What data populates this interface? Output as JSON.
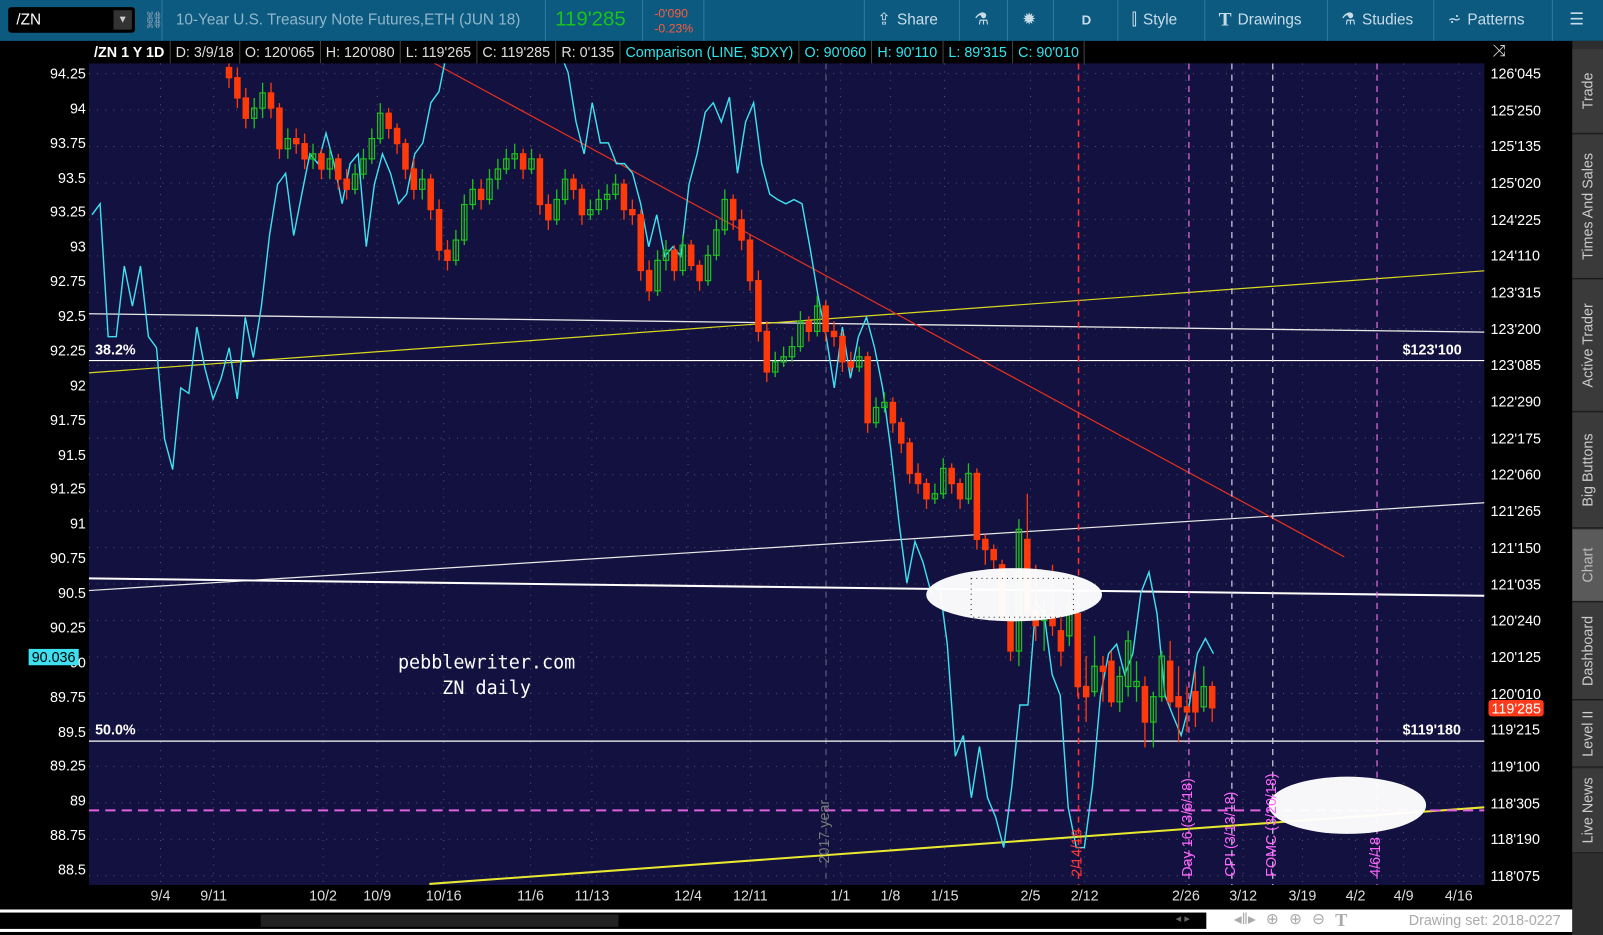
{
  "toolbar": {
    "symbol": "/ZN",
    "title": "10-Year U.S. Treasury Note Futures,ETH (JUN 18)",
    "last_price": "119'285",
    "net_change": "-0'090",
    "pct_change": "-0.23%",
    "share": "Share",
    "aggregation": "D",
    "style": "Style",
    "drawings": "Drawings",
    "studies": "Studies",
    "patterns": "Patterns",
    "icons": [
      "chevron-down-icon",
      "link-icon",
      "share-icon",
      "flask-icon",
      "gear-icon",
      "candles-icon",
      "text-t-icon",
      "flask-icon",
      "patterns-icon",
      "menu-icon"
    ]
  },
  "info": {
    "symbol": "/ZN 1 Y 1D",
    "date": "D: 3/9/18",
    "open": "O: 120'065",
    "high": "H: 120'080",
    "low": "L: 119'265",
    "close": "C: 119'285",
    "range": "R: 0'135",
    "comparison": "Comparison (LINE, $DXY)",
    "cmp_open": "O: 90'060",
    "cmp_high": "H: 90'110",
    "cmp_low": "L: 89'315",
    "cmp_close": "C: 90'010"
  },
  "colors": {
    "up": "#1fbf1f",
    "down": "#ff3a0a",
    "comparison": "#3ee0f0",
    "background": "#13113f",
    "toolbar": "#0d5a80"
  },
  "chart_data": {
    "type": "candlestick",
    "series": [
      {
        "name": "/ZN",
        "type": "candlestick",
        "ohlc_format": [
          "open",
          "high",
          "low",
          "close"
        ],
        "last_date": "3/9/18",
        "values": [
          [
            126.2,
            126.3,
            126.0,
            126.1
          ],
          [
            126.1,
            126.2,
            125.8,
            125.9
          ],
          [
            125.9,
            126.0,
            125.6,
            125.7
          ],
          [
            125.7,
            125.9,
            125.6,
            125.8
          ],
          [
            125.8,
            126.05,
            125.7,
            125.95
          ],
          [
            125.95,
            126.05,
            125.7,
            125.8
          ],
          [
            125.8,
            125.85,
            125.3,
            125.4
          ],
          [
            125.4,
            125.6,
            125.3,
            125.5
          ],
          [
            125.5,
            125.6,
            125.35,
            125.45
          ],
          [
            125.45,
            125.55,
            125.2,
            125.3
          ],
          [
            125.3,
            125.45,
            125.2,
            125.35
          ],
          [
            125.35,
            125.4,
            125.1,
            125.2
          ],
          [
            125.2,
            125.4,
            125.1,
            125.3
          ],
          [
            125.3,
            125.35,
            125.0,
            125.1
          ],
          [
            125.1,
            125.2,
            124.9,
            125.0
          ],
          [
            125.0,
            125.25,
            124.95,
            125.15
          ],
          [
            125.15,
            125.4,
            125.1,
            125.3
          ],
          [
            125.3,
            125.6,
            125.25,
            125.5
          ],
          [
            125.5,
            125.85,
            125.45,
            125.75
          ],
          [
            125.75,
            125.8,
            125.5,
            125.6
          ],
          [
            125.6,
            125.65,
            125.35,
            125.45
          ],
          [
            125.45,
            125.5,
            125.1,
            125.2
          ],
          [
            125.2,
            125.3,
            124.9,
            125.0
          ],
          [
            125.0,
            125.2,
            124.9,
            125.1
          ],
          [
            125.1,
            125.15,
            124.7,
            124.8
          ],
          [
            124.8,
            124.9,
            124.3,
            124.4
          ],
          [
            124.4,
            124.5,
            124.2,
            124.3
          ],
          [
            124.3,
            124.6,
            124.25,
            124.5
          ],
          [
            124.5,
            124.95,
            124.45,
            124.85
          ],
          [
            124.85,
            125.1,
            124.8,
            125.0
          ],
          [
            125.0,
            125.1,
            124.8,
            124.9
          ],
          [
            124.9,
            125.2,
            124.85,
            125.1
          ],
          [
            125.1,
            125.3,
            125.0,
            125.2
          ],
          [
            125.2,
            125.4,
            125.15,
            125.3
          ],
          [
            125.3,
            125.45,
            125.2,
            125.35
          ],
          [
            125.35,
            125.4,
            125.1,
            125.2
          ],
          [
            125.2,
            125.4,
            125.15,
            125.3
          ],
          [
            125.3,
            125.35,
            124.75,
            124.85
          ],
          [
            124.85,
            124.95,
            124.6,
            124.7
          ],
          [
            124.7,
            125.0,
            124.65,
            124.9
          ],
          [
            124.9,
            125.2,
            124.85,
            125.1
          ],
          [
            125.1,
            125.15,
            124.9,
            125.0
          ],
          [
            125.0,
            125.05,
            124.65,
            124.75
          ],
          [
            124.75,
            124.9,
            124.7,
            124.8
          ],
          [
            124.8,
            125.0,
            124.75,
            124.9
          ],
          [
            124.9,
            125.05,
            124.8,
            124.95
          ],
          [
            124.95,
            125.15,
            124.9,
            125.05
          ],
          [
            125.05,
            125.1,
            124.7,
            124.8
          ],
          [
            124.8,
            124.9,
            124.65,
            124.75
          ],
          [
            124.75,
            124.8,
            124.1,
            124.2
          ],
          [
            124.2,
            124.3,
            123.9,
            124.0
          ],
          [
            124.0,
            124.4,
            123.95,
            124.3
          ],
          [
            124.3,
            124.5,
            124.2,
            124.4
          ],
          [
            124.4,
            124.45,
            124.1,
            124.2
          ],
          [
            124.2,
            124.55,
            124.15,
            124.45
          ],
          [
            124.45,
            124.5,
            124.2,
            124.25
          ],
          [
            124.25,
            124.3,
            124.0,
            124.1
          ],
          [
            124.1,
            124.45,
            124.05,
            124.35
          ],
          [
            124.35,
            124.7,
            124.3,
            124.6
          ],
          [
            124.6,
            125.0,
            124.55,
            124.9
          ],
          [
            124.9,
            124.95,
            124.6,
            124.7
          ],
          [
            124.7,
            124.8,
            124.4,
            124.5
          ],
          [
            124.5,
            124.55,
            124.0,
            124.1
          ],
          [
            124.1,
            124.2,
            123.5,
            123.6
          ],
          [
            123.6,
            123.7,
            123.1,
            123.2
          ],
          [
            123.2,
            123.4,
            123.15,
            123.3
          ],
          [
            123.3,
            123.45,
            123.25,
            123.35
          ],
          [
            123.35,
            123.55,
            123.3,
            123.45
          ],
          [
            123.45,
            123.8,
            123.4,
            123.7
          ],
          [
            123.7,
            123.75,
            123.5,
            123.6
          ],
          [
            123.6,
            123.95,
            123.55,
            123.85
          ],
          [
            123.85,
            123.9,
            123.5,
            123.6
          ],
          [
            123.6,
            123.7,
            123.45,
            123.55
          ],
          [
            123.55,
            123.6,
            123.2,
            123.3
          ],
          [
            123.3,
            123.4,
            123.2,
            123.25
          ],
          [
            123.25,
            123.45,
            123.2,
            123.35
          ],
          [
            123.35,
            123.4,
            122.6,
            122.7
          ],
          [
            122.7,
            122.95,
            122.65,
            122.85
          ],
          [
            122.85,
            123.0,
            122.8,
            122.9
          ],
          [
            122.9,
            122.95,
            122.6,
            122.7
          ],
          [
            122.7,
            122.75,
            122.4,
            122.5
          ],
          [
            122.5,
            122.55,
            122.1,
            122.2
          ],
          [
            122.2,
            122.3,
            122.0,
            122.1
          ],
          [
            122.1,
            122.15,
            121.85,
            121.95
          ],
          [
            121.95,
            122.1,
            121.9,
            122.0
          ],
          [
            122.0,
            122.35,
            121.95,
            122.25
          ],
          [
            122.25,
            122.3,
            122.0,
            122.1
          ],
          [
            122.1,
            122.15,
            121.85,
            121.95
          ],
          [
            121.95,
            122.3,
            121.9,
            122.2
          ],
          [
            122.2,
            122.25,
            121.45,
            121.55
          ],
          [
            121.55,
            121.6,
            121.3,
            121.45
          ],
          [
            121.45,
            121.5,
            121.25,
            121.35
          ],
          [
            121.3,
            121.35,
            120.75,
            120.8
          ],
          [
            120.75,
            120.8,
            120.35,
            120.45
          ],
          [
            120.45,
            121.75,
            120.3,
            121.65
          ],
          [
            121.55,
            122.0,
            120.8,
            120.85
          ],
          [
            120.85,
            121.3,
            120.55,
            120.7
          ],
          [
            120.75,
            120.95,
            120.45,
            120.8
          ],
          [
            120.8,
            121.3,
            120.6,
            120.7
          ],
          [
            120.65,
            120.85,
            120.3,
            120.45
          ],
          [
            120.6,
            121.0,
            120.5,
            120.9
          ],
          [
            120.82,
            121.0,
            120.0,
            120.1
          ],
          [
            120.1,
            120.4,
            119.75,
            120.0
          ],
          [
            120.05,
            120.6,
            120.0,
            120.3
          ],
          [
            120.3,
            120.4,
            119.95,
            120.25
          ],
          [
            120.35,
            120.45,
            119.9,
            119.95
          ],
          [
            119.95,
            120.3,
            119.85,
            120.2
          ],
          [
            120.1,
            120.65,
            120.0,
            120.55
          ],
          [
            120.1,
            120.35,
            119.95,
            120.15
          ],
          [
            120.1,
            120.2,
            119.5,
            119.75
          ],
          [
            119.75,
            120.05,
            119.5,
            120.0
          ],
          [
            120.0,
            120.45,
            119.95,
            120.4
          ],
          [
            120.35,
            120.55,
            119.9,
            119.95
          ],
          [
            120.0,
            120.3,
            119.55,
            119.9
          ],
          [
            119.9,
            120.1,
            119.65,
            119.85
          ],
          [
            120.05,
            120.25,
            119.7,
            119.85
          ],
          [
            119.9,
            120.3,
            119.85,
            120.1
          ],
          [
            120.1,
            120.15,
            119.75,
            119.89
          ]
        ]
      },
      {
        "name": "$DXY",
        "type": "line",
        "last_date": "3/9/18",
        "values": [
          93.23,
          93.31,
          92.35,
          92.35,
          92.86,
          92.57,
          92.86,
          92.35,
          92.27,
          91.61,
          91.39,
          91.98,
          91.94,
          92.42,
          92.12,
          91.9,
          92.05,
          92.27,
          91.9,
          92.49,
          92.2,
          92.57,
          93.08,
          93.45,
          93.53,
          93.08,
          93.38,
          93.67,
          93.6,
          93.82,
          93.6,
          93.31,
          93.6,
          93.67,
          93.0,
          93.45,
          93.67,
          93.53,
          93.31,
          93.38,
          93.67,
          93.75,
          94.04,
          94.12,
          94.41,
          94.6,
          94.7,
          94.6,
          94.5,
          94.6,
          94.7,
          94.8,
          94.6,
          94.5,
          94.6,
          94.7,
          94.6,
          94.5,
          94.4,
          94.26,
          93.9,
          93.67,
          94.04,
          93.75,
          93.75,
          93.6,
          93.6,
          93.53,
          93.31,
          93.0,
          93.23,
          92.93,
          93.0,
          92.93,
          93.45,
          93.67,
          93.97,
          94.04,
          93.9,
          94.08,
          93.53,
          93.9,
          94.04,
          93.6,
          93.38,
          93.34,
          93.31,
          93.34,
          93.31,
          92.99,
          92.64,
          92.35,
          91.98,
          92.42,
          92.05,
          92.35,
          92.49,
          92.27,
          91.98,
          91.54,
          91.02,
          90.57,
          90.87,
          90.72,
          90.5,
          90.57,
          90.13,
          89.32,
          89.47,
          89.02,
          89.39,
          89.02,
          88.88,
          88.66,
          89.1,
          89.69,
          89.69,
          90.43,
          90.35,
          89.91,
          89.76,
          88.95,
          88.66,
          88.66,
          89.1,
          89.76,
          90.06,
          90.13,
          89.91,
          90.06,
          90.5,
          90.65,
          90.35,
          89.76,
          89.61,
          89.47,
          89.69,
          90.06,
          90.17,
          90.06
        ]
      }
    ],
    "right_axis_ticks": [
      "126'045",
      "125'250",
      "125'135",
      "125'020",
      "124'225",
      "124'110",
      "123'315",
      "123'200",
      "123'085",
      "122'290",
      "122'175",
      "122'060",
      "121'265",
      "121'150",
      "121'035",
      "120'240",
      "120'125",
      "120'010",
      "119'215",
      "119'100",
      "118'305",
      "118'190",
      "118'075"
    ],
    "left_axis_ticks": [
      "94.25",
      "94",
      "93.75",
      "93.5",
      "93.25",
      "93",
      "92.75",
      "92.5",
      "92.25",
      "92",
      "91.75",
      "91.5",
      "91.25",
      "91",
      "90.75",
      "90.5",
      "90.25",
      "90",
      "89.75",
      "89.5",
      "89.25",
      "89",
      "88.75",
      "88.5"
    ],
    "x_ticks": [
      "9/4",
      "9/11",
      "10/2",
      "10/9",
      "10/16",
      "11/6",
      "11/13",
      "12/4",
      "12/11",
      "1/1",
      "1/8",
      "1/15",
      "2/5",
      "2/12",
      "2/26",
      "3/12",
      "3/19",
      "4/2",
      "4/9",
      "4/16"
    ],
    "right_ylim": [
      "118'075",
      "126'045"
    ],
    "left_ylim": [
      88.5,
      94.25
    ],
    "grid": true,
    "last_price_badge": "119'285",
    "comparison_badge": "90.036",
    "levels": [
      {
        "label": "38.2%",
        "price_label": "$123'100",
        "price": 123.3125
      },
      {
        "label": "50.0%",
        "price_label": "$119'180",
        "price": 119.5625
      }
    ],
    "event_markers": [
      {
        "label": "2017 year",
        "color": "#777777"
      },
      {
        "label": "2/14/18",
        "color": "#ff3a3a"
      },
      {
        "label": "Day 16 (3/6/18)",
        "color": "#ff66ff"
      },
      {
        "label": "CPI (3/13/18)",
        "color": "#ff66ff"
      },
      {
        "label": "FOMC (3/20/18)",
        "color": "#ff66ff"
      },
      {
        "label": "4/6/18",
        "color": "#ff66ff"
      }
    ],
    "annotation": [
      "pebblewriter.com",
      "ZN daily"
    ]
  },
  "bottombar": {
    "drawing_set": "Drawing set: 2018-0227",
    "icons": [
      "pan-icon",
      "crosshair-icon",
      "zoom-in-icon",
      "zoom-out-icon",
      "text-t-icon"
    ]
  },
  "sidebar": {
    "tabs": [
      "Trade",
      "Times And Sales",
      "Active Trader",
      "Big Buttons",
      "Chart",
      "Dashboard",
      "Level II",
      "Live News"
    ],
    "selected": "Chart"
  }
}
